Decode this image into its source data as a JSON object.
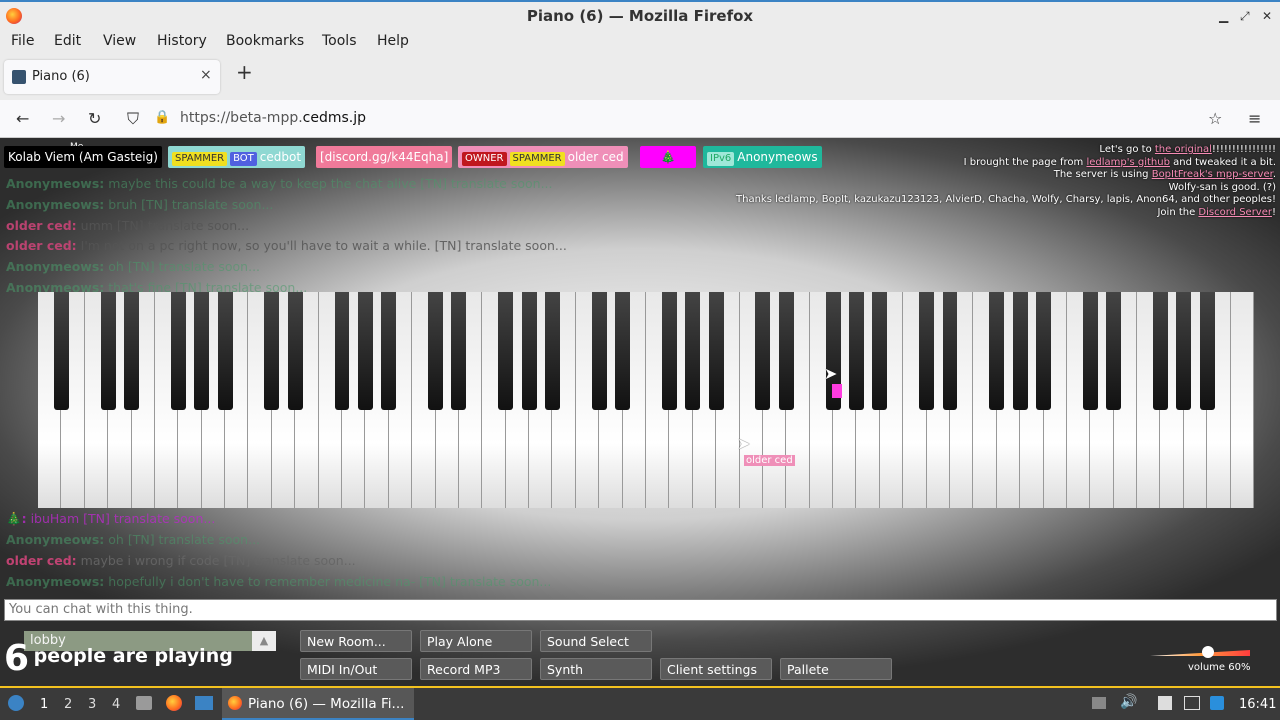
{
  "window": {
    "title": "Piano (6) — Mozilla Firefox"
  },
  "menu": [
    "File",
    "Edit",
    "View",
    "History",
    "Bookmarks",
    "Tools",
    "Help"
  ],
  "tab": {
    "label": "Piano (6)",
    "close": "×",
    "new": "+"
  },
  "nav": {
    "back": "←",
    "forward": "→",
    "reload": "↻",
    "shield": "⛉",
    "lock": "🔒",
    "url_prefix": "https://beta-mpp.",
    "url_host": "cedms.jp",
    "star": "☆",
    "menu": "≡"
  },
  "users": {
    "me_marker": "Me",
    "u1": "Kolab Viem (Am Gasteig)",
    "u2_spammer": "SPAMMER",
    "u2_bot": "BOT",
    "u2_name": "cedbot",
    "u3": "[discord.gg/k44Eqha]",
    "u4_owner": "OWNER",
    "u4_spammer": "SPAMMER",
    "u4_name": "older ced",
    "u5": "🎄",
    "u6_tag": "IPv6",
    "u6_name": "Anonymeows"
  },
  "info": {
    "l1_pre": "Let's go to ",
    "l1_link": "the original",
    "l1_post": "!!!!!!!!!!!!!!!!",
    "l2_pre": "I brought the page from ",
    "l2_link": "ledlamp's github",
    "l2_post": " and tweaked it a bit.",
    "l3_pre": "The server is using ",
    "l3_link": "BopItFreak's mpp-server",
    "l3_post": ".",
    "l4": "Wolfy-san is good. (?)",
    "l5": "Thanks ledlamp, BopIt, kazukazu123123, AlvierD, Chacha, Wolfy, Charsy, lapis, Anon64, and other peoples!",
    "l6_pre": "Join the ",
    "l6_link": "Discord Server",
    "l6_post": "!"
  },
  "chat": [
    {
      "name": "Anonymeows:",
      "msg": "maybe this could be a way to keep the chat alive [TN] translate soon..."
    },
    {
      "name": "Anonymeows:",
      "msg": "bruh [TN] translate soon..."
    },
    {
      "name": "older ced:",
      "msg": "umm [TN] translate soon..."
    },
    {
      "name": "older ced:",
      "msg": "I'm not on a pc right now, so you'll have to wait a while. [TN] translate soon..."
    },
    {
      "name": "Anonymeows:",
      "msg": "oh [TN] translate soon..."
    },
    {
      "name": "Anonymeows:",
      "msg": "that's fine [TN] translate soon..."
    },
    {
      "name": "🎄:",
      "msg": "ibuHam [TN] translate soon..."
    },
    {
      "name": "Anonymeows:",
      "msg": "oh [TN] translate soon..."
    },
    {
      "name": "older ced:",
      "msg": "maybe i wrong if code [TN] translate soon..."
    },
    {
      "name": "Anonymeows:",
      "msg": "hopefully i don't have to remember medicine na- [TN] translate soon..."
    }
  ],
  "cursor_label": "older ced",
  "input_placeholder": "You can chat with this thing.",
  "room": {
    "name": "lobby",
    "arrow": "▲"
  },
  "count": {
    "num": "6",
    "label": "people are playing"
  },
  "buttons": {
    "new_room": "New Room...",
    "play_alone": "Play Alone",
    "sound_select": "Sound Select",
    "midi": "MIDI In/Out",
    "record": "Record MP3",
    "synth": "Synth",
    "client": "Client settings",
    "pallete": "Pallete"
  },
  "volume": {
    "label": "volume 60%",
    "level": 0.6
  },
  "panel": {
    "ws": [
      "1",
      "2",
      "3",
      "4"
    ],
    "app": "Piano (6) — Mozilla Fi...",
    "clock": "16:41"
  },
  "colors": {
    "ipv6": "#1fb89c",
    "owner": "#c0171e",
    "spammer": "#f0e020",
    "bot": "#5060e0",
    "accent": "#3b83c4"
  }
}
